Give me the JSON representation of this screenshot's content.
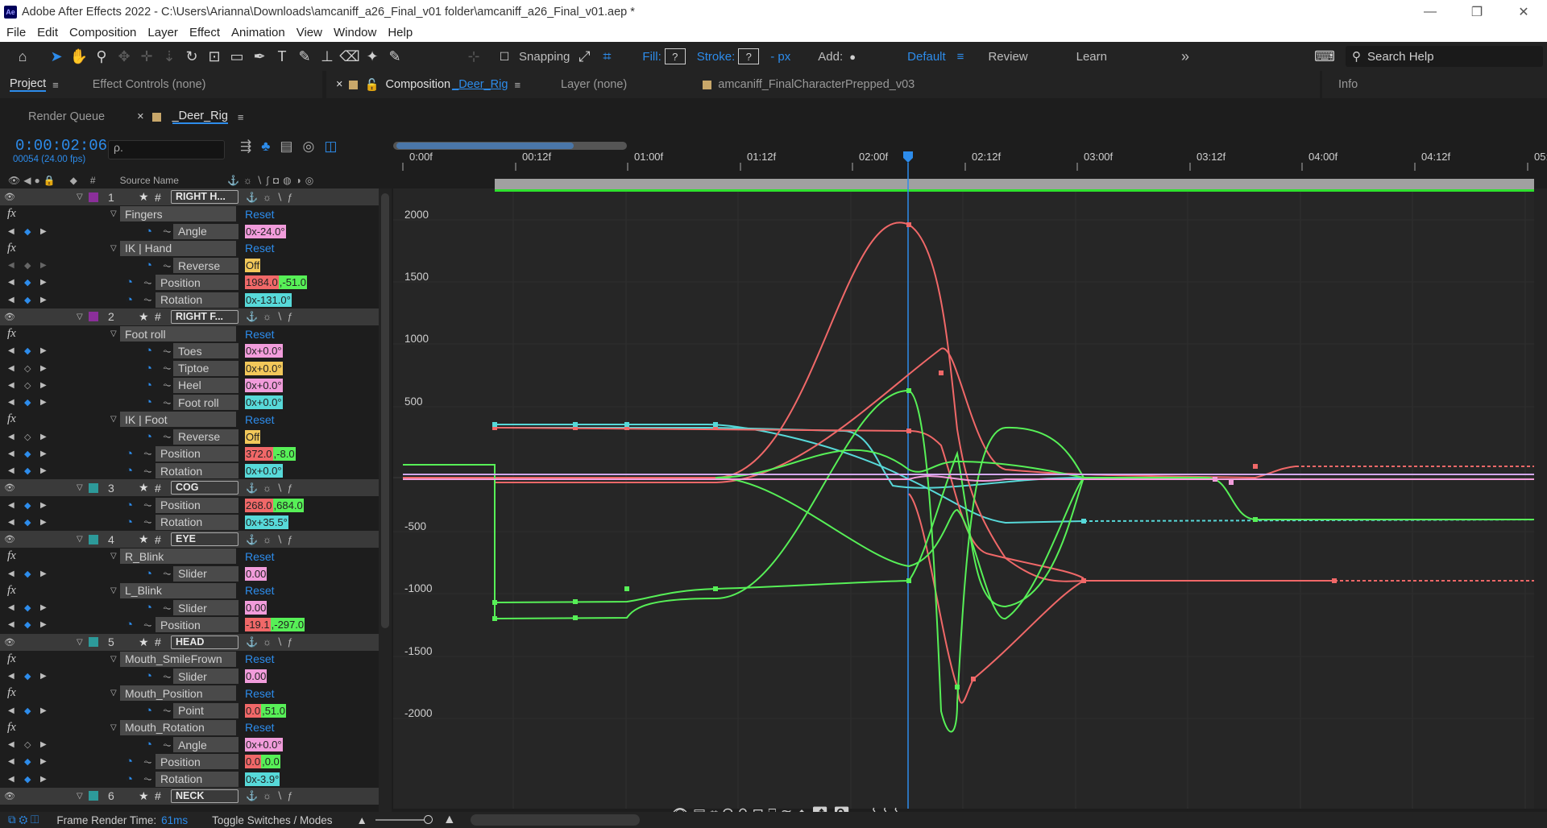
{
  "titlebar": {
    "logo": "Ae",
    "title": "Adobe After Effects 2022 - C:\\Users\\Arianna\\Downloads\\amcaniff_a26_Final_v01 folder\\amcaniff_a26_Final_v01.aep *",
    "minimize": "—",
    "restore": "❐",
    "close": "✕"
  },
  "menu": [
    "File",
    "Edit",
    "Composition",
    "Layer",
    "Effect",
    "Animation",
    "View",
    "Window",
    "Help"
  ],
  "toolbar": {
    "snapping": "Snapping",
    "fill": "Fill:",
    "fill_value": "?",
    "stroke": "Stroke:",
    "stroke_value": "?",
    "stroke_px": "- px",
    "add": "Add:",
    "workspaces": [
      "Default",
      "Review",
      "Learn"
    ],
    "search_placeholder": "Search Help",
    "more": "»"
  },
  "panels": {
    "project": "Project",
    "effect_controls": "Effect Controls (none)",
    "composition_prefix": "Composition ",
    "composition_name": "_Deer_Rig",
    "layer": "Layer  (none)",
    "footage": "amcaniff_FinalCharacterPrepped_v03",
    "info": "Info"
  },
  "timeline": {
    "render_queue": "Render Queue",
    "comp_tab": "_Deer_Rig",
    "timecode": "0:00:02:06",
    "frames": "00054 (24.00 fps)",
    "search_placeholder": "ρ.",
    "source_name": "Source Name",
    "num": "#"
  },
  "ruler": [
    "0:00f",
    "00:12f",
    "01:00f",
    "01:12f",
    "02:00f",
    "02:12f",
    "03:00f",
    "03:12f",
    "04:00f",
    "04:12f",
    "05:0"
  ],
  "graph_axis": [
    "2000",
    "1500",
    "1000",
    "500",
    "-500",
    "-1000",
    "-1500",
    "-2000"
  ],
  "rows": [
    {
      "t": "layer",
      "num": "1",
      "name": "RIGHT H...",
      "color": "#8b2f9a"
    },
    {
      "t": "fx",
      "name": "Fingers",
      "reset": "Reset"
    },
    {
      "t": "prop",
      "name": "Angle",
      "vals": [
        [
          "0x-24.0°",
          "c-pink"
        ]
      ],
      "kf": "both"
    },
    {
      "t": "fx",
      "name": "IK | Hand",
      "reset": "Reset"
    },
    {
      "t": "prop",
      "name": "Reverse",
      "vals": [
        [
          "Off",
          "c-yellow"
        ]
      ],
      "kf": "dim"
    },
    {
      "t": "prop2",
      "name": "Position",
      "vals": [
        [
          "1984.0",
          "c-red"
        ],
        [
          ",-51.0",
          "c-green"
        ]
      ],
      "kf": "both"
    },
    {
      "t": "prop2",
      "name": "Rotation",
      "vals": [
        [
          "0x-131.0°",
          "c-cyan"
        ]
      ],
      "kf": "both"
    },
    {
      "t": "layer",
      "num": "2",
      "name": "RIGHT F...",
      "color": "#8b2f9a"
    },
    {
      "t": "fx",
      "name": "Foot roll",
      "reset": "Reset"
    },
    {
      "t": "prop",
      "name": "Toes",
      "vals": [
        [
          "0x+0.0°",
          "c-pink"
        ]
      ],
      "kf": "both"
    },
    {
      "t": "prop",
      "name": "Tiptoe",
      "vals": [
        [
          "0x+0.0°",
          "c-yellow"
        ]
      ],
      "kf": "hol"
    },
    {
      "t": "prop",
      "name": "Heel",
      "vals": [
        [
          "0x+0.0°",
          "c-pink"
        ]
      ],
      "kf": "hol"
    },
    {
      "t": "prop",
      "name": "Foot roll",
      "vals": [
        [
          "0x+0.0°",
          "c-cyan"
        ]
      ],
      "kf": "both"
    },
    {
      "t": "fx",
      "name": "IK | Foot",
      "reset": "Reset"
    },
    {
      "t": "prop",
      "name": "Reverse",
      "vals": [
        [
          "Off",
          "c-yellow"
        ]
      ],
      "kf": "hol"
    },
    {
      "t": "prop2",
      "name": "Position",
      "vals": [
        [
          "372.0",
          "c-red"
        ],
        [
          ",-8.0",
          "c-green"
        ]
      ],
      "kf": "both"
    },
    {
      "t": "prop2",
      "name": "Rotation",
      "vals": [
        [
          "0x+0.0°",
          "c-cyan"
        ]
      ],
      "kf": "both"
    },
    {
      "t": "layer",
      "num": "3",
      "name": "COG",
      "color": "#2d9a9a"
    },
    {
      "t": "prop1",
      "name": "Position",
      "vals": [
        [
          "268.0",
          "c-red"
        ],
        [
          ",684.0",
          "c-green"
        ]
      ],
      "kf": "both"
    },
    {
      "t": "prop1",
      "name": "Rotation",
      "vals": [
        [
          "0x+35.5°",
          "c-cyan"
        ]
      ],
      "kf": "both"
    },
    {
      "t": "layer",
      "num": "4",
      "name": "EYE",
      "color": "#2d9a9a"
    },
    {
      "t": "fx",
      "name": "R_Blink",
      "reset": "Reset"
    },
    {
      "t": "prop",
      "name": "Slider",
      "vals": [
        [
          "0.00",
          "c-pink"
        ]
      ],
      "kf": "both"
    },
    {
      "t": "fx",
      "name": "L_Blink",
      "reset": "Reset"
    },
    {
      "t": "prop",
      "name": "Slider",
      "vals": [
        [
          "0.00",
          "c-pink"
        ]
      ],
      "kf": "both"
    },
    {
      "t": "prop1",
      "name": "Position",
      "vals": [
        [
          "-19.1",
          "c-red"
        ],
        [
          ",-297.0",
          "c-green"
        ]
      ],
      "kf": "both"
    },
    {
      "t": "layer",
      "num": "5",
      "name": "HEAD",
      "color": "#2d9a9a"
    },
    {
      "t": "fx",
      "name": "Mouth_SmileFrown",
      "reset": "Reset"
    },
    {
      "t": "prop",
      "name": "Slider",
      "vals": [
        [
          "0.00",
          "c-pink"
        ]
      ],
      "kf": "both"
    },
    {
      "t": "fx",
      "name": "Mouth_Position",
      "reset": "Reset"
    },
    {
      "t": "prop",
      "name": "Point",
      "vals": [
        [
          "0.0",
          "c-red"
        ],
        [
          ",51.0",
          "c-green"
        ]
      ],
      "kf": "both"
    },
    {
      "t": "fx",
      "name": "Mouth_Rotation",
      "reset": "Reset"
    },
    {
      "t": "prop",
      "name": "Angle",
      "vals": [
        [
          "0x+0.0°",
          "c-pink"
        ]
      ],
      "kf": "hol"
    },
    {
      "t": "prop1",
      "name": "Position",
      "vals": [
        [
          "0.0",
          "c-red"
        ],
        [
          ",0.0",
          "c-green"
        ]
      ],
      "kf": "both"
    },
    {
      "t": "prop1",
      "name": "Rotation",
      "vals": [
        [
          "0x-3.9°",
          "c-cyan"
        ]
      ],
      "kf": "both"
    },
    {
      "t": "layer",
      "num": "6",
      "name": "NECK",
      "color": "#2d9a9a"
    }
  ],
  "status": {
    "label": "Frame Render Time:",
    "value": "61ms",
    "toggle": "Toggle Switches / Modes"
  },
  "colors": {
    "accent": "#2d8ceb",
    "red": "#f06868",
    "green": "#57f057",
    "cyan": "#57d9d9",
    "pink": "#f19cdb"
  }
}
